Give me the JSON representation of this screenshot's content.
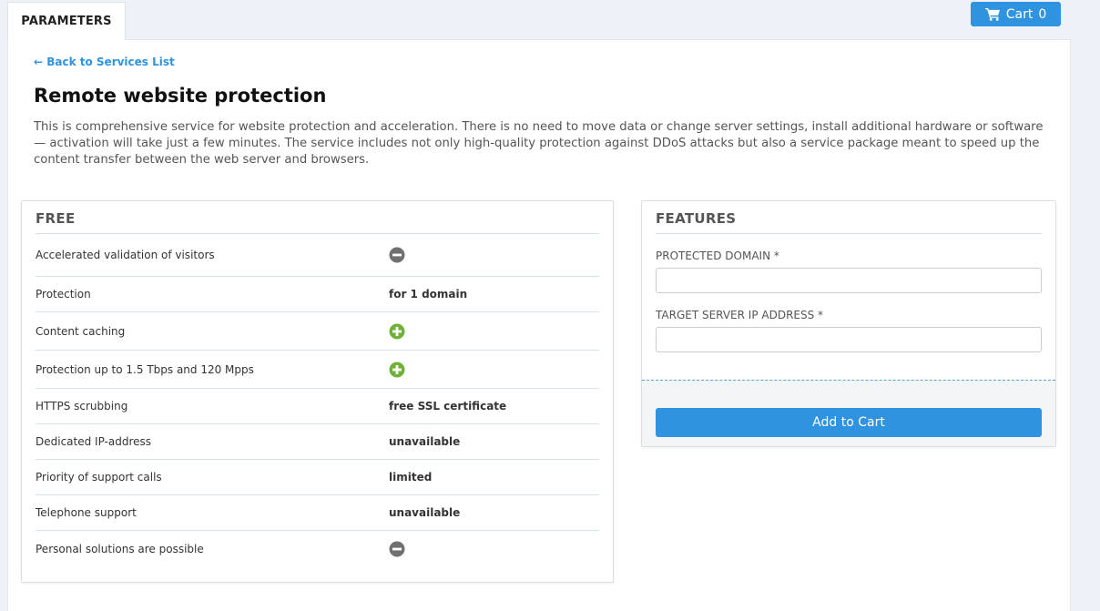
{
  "tab": {
    "label": "PARAMETERS"
  },
  "cart": {
    "label": "Cart",
    "count": "0"
  },
  "back_link": "← Back to Services List",
  "title": "Remote website protection",
  "description": "This is comprehensive service for website protection and acceleration. There is no need to move data or change server settings, install additional hardware or software — activation will take just a few minutes. The service includes not only high-quality protection against DDoS attacks but also a service package meant to speed up the content transfer between the web server and browsers.",
  "free": {
    "heading": "FREE",
    "rows": [
      {
        "label": "Accelerated validation of visitors",
        "icon": "minus-circle-icon"
      },
      {
        "label": "Protection",
        "value": "for 1 domain"
      },
      {
        "label": "Content caching",
        "icon": "plus-circle-icon"
      },
      {
        "label": "Protection up to 1.5 Tbps and 120 Mpps",
        "icon": "plus-circle-icon"
      },
      {
        "label": "HTTPS scrubbing",
        "value": "free SSL certificate"
      },
      {
        "label": "Dedicated IP-address",
        "value": "unavailable"
      },
      {
        "label": "Priority of support calls",
        "value": "limited"
      },
      {
        "label": "Telephone support",
        "value": "unavailable"
      },
      {
        "label": "Personal solutions are possible",
        "icon": "minus-circle-icon"
      }
    ]
  },
  "features": {
    "heading": "FEATURES",
    "domain_label": "PROTECTED DOMAIN *",
    "domain_value": "",
    "ip_label": "TARGET SERVER IP ADDRESS *",
    "ip_value": "",
    "add_button": "Add to Cart"
  },
  "colors": {
    "accent": "#2f93e0",
    "plus_icon": "#6fb238",
    "minus_icon": "#707070"
  }
}
